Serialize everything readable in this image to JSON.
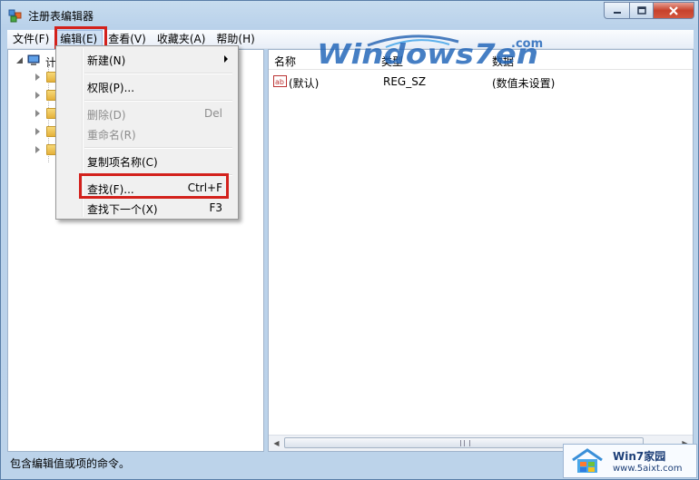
{
  "window": {
    "title": "注册表编辑器",
    "icon": "regedit-icon",
    "buttons": {
      "minimize": "minimize-icon",
      "maximize": "maximize-icon",
      "close": "close-icon"
    }
  },
  "menubar": {
    "items": [
      {
        "label": "文件(F)"
      },
      {
        "label": "编辑(E)",
        "active": true
      },
      {
        "label": "查看(V)"
      },
      {
        "label": "收藏夹(A)"
      },
      {
        "label": "帮助(H)"
      }
    ]
  },
  "edit_menu": {
    "items": [
      {
        "label": "新建(N)",
        "submenu": true
      },
      {
        "label": "权限(P)..."
      },
      {
        "label": "删除(D)",
        "shortcut": "Del",
        "disabled": true
      },
      {
        "label": "重命名(R)",
        "disabled": true
      },
      {
        "label": "复制项名称(C)"
      },
      {
        "label": "查找(F)...",
        "shortcut": "Ctrl+F",
        "highlighted_box": true
      },
      {
        "label": "查找下一个(X)",
        "shortcut": "F3"
      }
    ]
  },
  "tree": {
    "root_label": "计",
    "root_icon": "computer-icon",
    "child_count_visible": 5,
    "child_icon": "folder-icon"
  },
  "list": {
    "columns": [
      "名称",
      "类型",
      "数据"
    ],
    "rows": [
      {
        "icon": "string-value-icon",
        "name": "(默认)",
        "type": "REG_SZ",
        "data": "(数值未设置)"
      }
    ]
  },
  "statusbar": {
    "text": "包含编辑值或项的命令。"
  },
  "watermark": {
    "top_logo_text": "Windows7en",
    "top_logo_suffix": ".com",
    "badge_title": "Win7家园",
    "badge_url": "www.5aixt.com"
  },
  "colors": {
    "highlight_box": "#d3211c",
    "title_bar": "#c7dcef"
  }
}
